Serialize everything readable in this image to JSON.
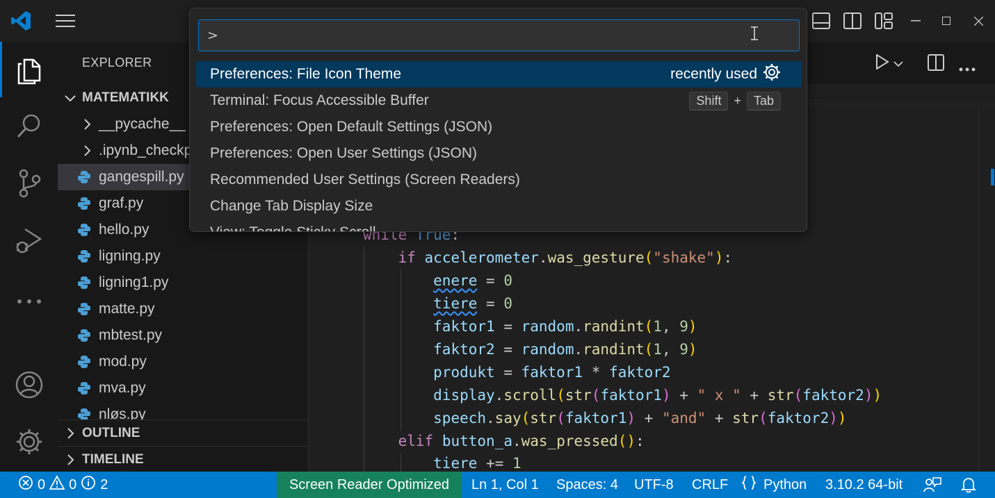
{
  "palette": {
    "input_value": ">",
    "items": [
      {
        "label": "Preferences: File Icon Theme",
        "hint": "recently used"
      },
      {
        "label": "Terminal: Focus Accessible Buffer",
        "keys": [
          "Shift",
          "Tab"
        ],
        "key_sep": "+"
      },
      {
        "label": "Preferences: Open Default Settings (JSON)"
      },
      {
        "label": "Preferences: Open User Settings (JSON)"
      },
      {
        "label": "Recommended User Settings (Screen Readers)"
      },
      {
        "label": "Change Tab Display Size"
      },
      {
        "label": "View: Toggle Sticky Scroll"
      }
    ]
  },
  "sidebar": {
    "title": "EXPLORER",
    "folder": "MATEMATIKK",
    "folders": [
      "__pycache__",
      ".ipynb_checkpoints"
    ],
    "files": [
      "gangespill.py",
      "graf.py",
      "hello.py",
      "ligning.py",
      "ligning1.py",
      "matte.py",
      "mbtest.py",
      "mod.py",
      "mva.py",
      "nløs.py"
    ],
    "sections": [
      "OUTLINE",
      "TIMELINE"
    ]
  },
  "editor": {
    "lines": [
      "while True:",
      "    if accelerometer.was_gesture(\"shake\"):",
      "        enere = 0",
      "        tiere = 0",
      "        faktor1 = random.randint(1, 9)",
      "        faktor2 = random.randint(1, 9)",
      "        produkt = faktor1 * faktor2",
      "        display.scroll(str(faktor1) + \" x \" + str(faktor2))",
      "        speech.say(str(faktor1) + \"and\" + str(faktor2))",
      "    elif button_a.was_pressed():",
      "        tiere += 1"
    ]
  },
  "statusbar": {
    "errors": "0",
    "warnings": "0",
    "infos": "2",
    "screen_reader": "Screen Reader Optimized",
    "position": "Ln 1, Col 1",
    "spaces": "Spaces: 4",
    "encoding": "UTF-8",
    "eol": "CRLF",
    "language": "Python",
    "interpreter": "3.10.2 64-bit"
  },
  "colors": {
    "accent": "#0078d4",
    "statusbar": "#007acc",
    "screen_reader_bg": "#16825d",
    "selection": "#04395e"
  }
}
